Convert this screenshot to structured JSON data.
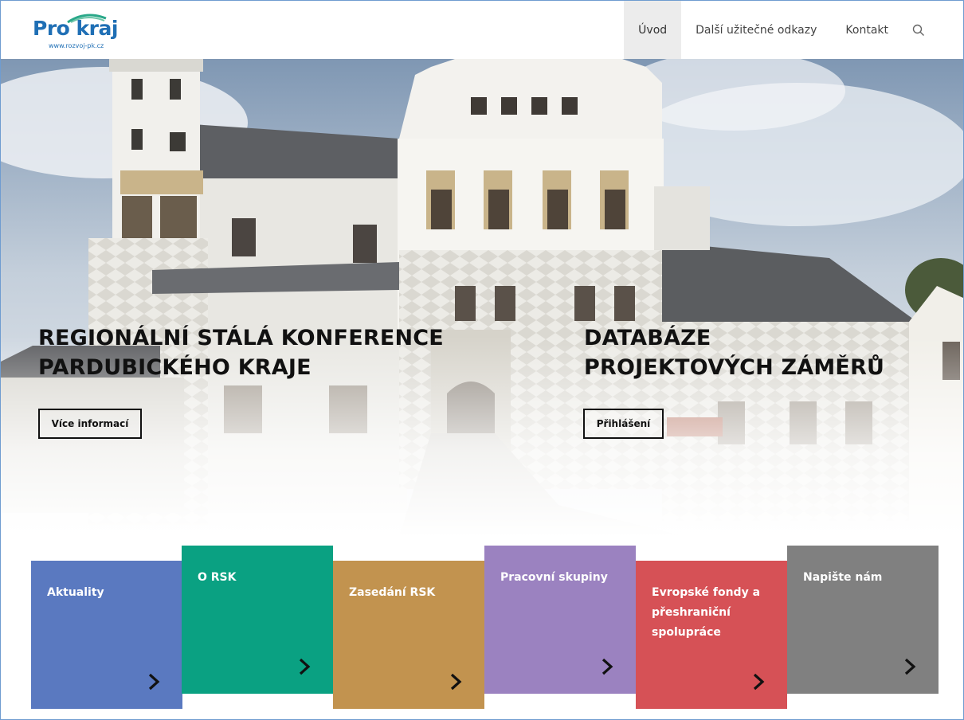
{
  "header": {
    "logo": {
      "text": "Pro kraj",
      "url": "www.rozvoj-pk.cz"
    },
    "nav": [
      {
        "label": "Úvod",
        "active": true
      },
      {
        "label": "Další užitečné odkazy",
        "active": false
      },
      {
        "label": "Kontakt",
        "active": false
      }
    ],
    "search_icon": "search-icon"
  },
  "hero": {
    "left": {
      "title_line1": "REGIONÁLNÍ STÁLÁ KONFERENCE",
      "title_line2": "PARDUBICKÉHO KRAJE",
      "button": "Více informací"
    },
    "right": {
      "title_line1": "DATABÁZE",
      "title_line2": "PROJEKTOVÝCH ZÁMĚRŮ",
      "button": "Přihlášení"
    }
  },
  "tiles": [
    {
      "label": "Aktuality",
      "color": "#5a79c0"
    },
    {
      "label": "O RSK",
      "color": "#0aa182"
    },
    {
      "label": "Zasedání RSK",
      "color": "#c2934f"
    },
    {
      "label": "Pracovní skupiny",
      "color": "#9b82c0"
    },
    {
      "label": "Evropské fondy a přeshraniční spolupráce",
      "color": "#d65156"
    },
    {
      "label": "Napište nám",
      "color": "#808080"
    }
  ],
  "tile_arrow_icon": "chevron-right-icon"
}
